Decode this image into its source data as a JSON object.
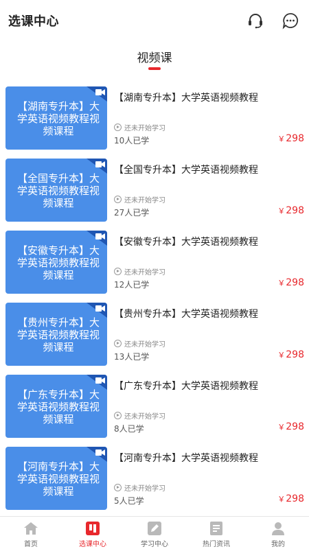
{
  "header": {
    "title": "选课中心",
    "icons": [
      "headset-icon",
      "chat-bubble-icon"
    ]
  },
  "section": {
    "tab_label": "视频课"
  },
  "courses": [
    {
      "thumb_text": "【湖南专升本】大学英语视频教程视频课程",
      "title": "【湖南专升本】大学英语视频教程",
      "status": "还未开始学习",
      "learners": "10人已学",
      "currency": "￥",
      "price": "298"
    },
    {
      "thumb_text": "【全国专升本】大学英语视频教程视频课程",
      "title": "【全国专升本】大学英语视频教程",
      "status": "还未开始学习",
      "learners": "27人已学",
      "currency": "￥",
      "price": "298"
    },
    {
      "thumb_text": "【安徽专升本】大学英语视频教程视频课程",
      "title": "【安徽专升本】大学英语视频教程",
      "status": "还未开始学习",
      "learners": "12人已学",
      "currency": "￥",
      "price": "298"
    },
    {
      "thumb_text": "【贵州专升本】大学英语视频教程视频课程",
      "title": "【贵州专升本】大学英语视频教程",
      "status": "还未开始学习",
      "learners": "13人已学",
      "currency": "￥",
      "price": "298"
    },
    {
      "thumb_text": "【广东专升本】大学英语视频教程视频课程",
      "title": "【广东专升本】大学英语视频教程",
      "status": "还未开始学习",
      "learners": "8人已学",
      "currency": "￥",
      "price": "298"
    },
    {
      "thumb_text": "【河南专升本】大学英语视频教程视频课程",
      "title": "【河南专升本】大学英语视频教程",
      "status": "还未开始学习",
      "learners": "5人已学",
      "currency": "￥",
      "price": "298"
    }
  ],
  "bottom_nav": {
    "items": [
      {
        "label": "首页",
        "icon": "home-icon",
        "active": false
      },
      {
        "label": "选课中心",
        "icon": "course-select-icon",
        "active": true
      },
      {
        "label": "学习中心",
        "icon": "study-edit-icon",
        "active": false
      },
      {
        "label": "热门资讯",
        "icon": "news-icon",
        "active": false
      },
      {
        "label": "我的",
        "icon": "profile-icon",
        "active": false
      }
    ]
  },
  "colors": {
    "accent": "#e8282d",
    "thumb_bg": "#4a8ee8",
    "thumb_corner": "#1f56b3",
    "nav_inactive_icon": "#b9b9b9"
  }
}
